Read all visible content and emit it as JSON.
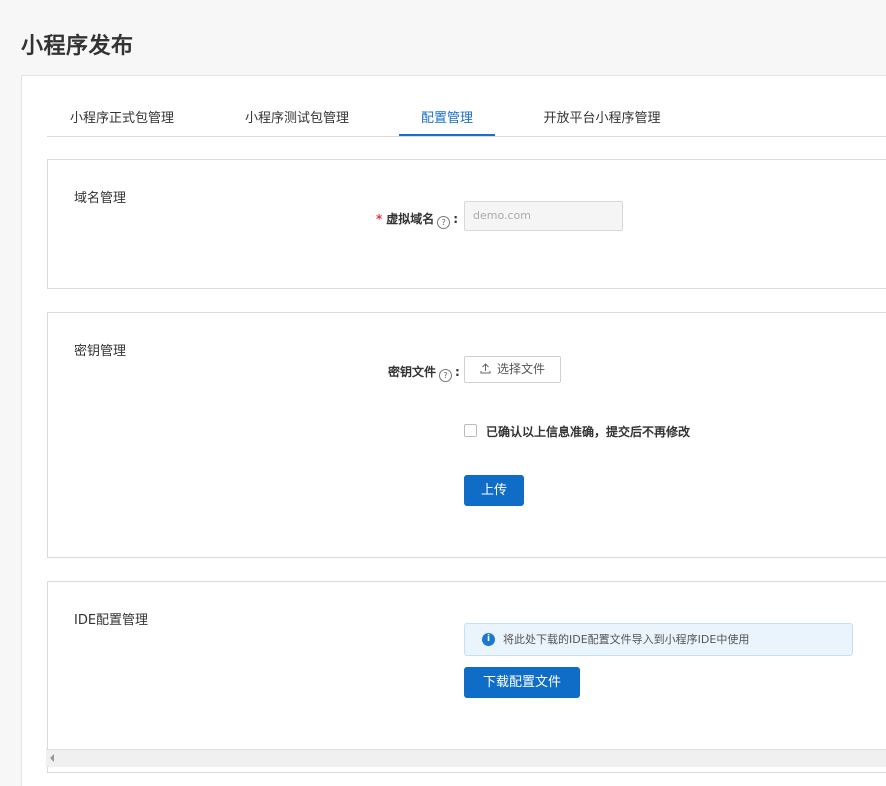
{
  "page": {
    "title": "小程序发布"
  },
  "tabs": [
    {
      "label": "小程序正式包管理",
      "active": false
    },
    {
      "label": "小程序测试包管理",
      "active": false
    },
    {
      "label": "配置管理",
      "active": true
    },
    {
      "label": "开放平台小程序管理",
      "active": false
    }
  ],
  "domain_section": {
    "title": "域名管理",
    "field_label": "虚拟域名",
    "required_mark": "*",
    "help_icon": "?",
    "colon": ":",
    "input_placeholder": "demo.com"
  },
  "key_section": {
    "title": "密钥管理",
    "field_label": "密钥文件",
    "help_icon": "?",
    "colon": ":",
    "upload_icon": "upload-icon",
    "upload_label": "选择文件",
    "confirm_label": "已确认以上信息准确，提交后不再修改",
    "confirm_checked": false,
    "submit_label": "上传"
  },
  "ide_section": {
    "title": "IDE配置管理",
    "info_icon": "i",
    "info_text": "将此处下载的IDE配置文件导入到小程序IDE中使用",
    "download_label": "下载配置文件"
  },
  "colors": {
    "accent": "#1a6fc9",
    "primary_button": "#0f6dc7",
    "info_background": "#eaf4fc",
    "required": "#e53935"
  }
}
